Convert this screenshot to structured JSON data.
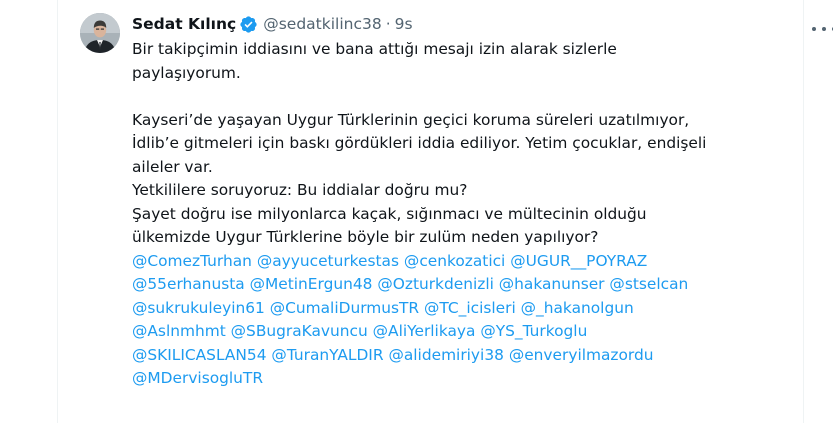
{
  "tweet": {
    "author_name": "Sedat Kılınç",
    "handle": "@sedatkilinc38",
    "separator": "·",
    "time": "9s",
    "verified_color": "#1d9bf0",
    "mention_color": "#1d9bf0",
    "paragraph1_lines": [
      "Bir takipçimin iddiasını ve bana attığı mesajı izin alarak sizlerle",
      "paylaşıyorum."
    ],
    "paragraph2_lines": [
      "Kayseri’de yaşayan Uygur Türklerinin geçici koruma süreleri uzatılmıyor,",
      "İdlib’e gitmeleri için baskı gördükleri iddia ediliyor. Yetim çocuklar, endişeli",
      "aileler var.",
      "Yetkililere soruyoruz: Bu iddialar doğru mu?",
      "Şayet doğru ise milyonlarca kaçak, sığınmacı ve mültecinin olduğu",
      "ülkemizde Uygur Türklerine böyle bir zulüm neden yapılıyor?"
    ],
    "mentions": [
      "@ComezTurhan",
      "@ayyuceturkestas",
      "@cenkozatici",
      "@UGUR__POYRAZ",
      "@55erhanusta",
      "@MetinErgun48",
      "@Ozturkdenizli",
      "@hakanunser",
      "@stselcan",
      "@sukrukuleyin61",
      "@CumaliDurmusTR",
      "@TC_icisleri",
      "@_hakanolgun",
      "@Aslnmhmt",
      "@SBugraKavuncu",
      "@AliYerlikaya",
      "@YS_Turkoglu",
      "@SKILICASLAN54",
      "@TuranYALDIR",
      "@alidemiriyi38",
      "@enveryilmazordu",
      "@MDervisogluTR"
    ],
    "icons": {
      "avatar": "profile-photo",
      "verified": "verified-badge-icon",
      "more": "more-options-icon"
    }
  }
}
